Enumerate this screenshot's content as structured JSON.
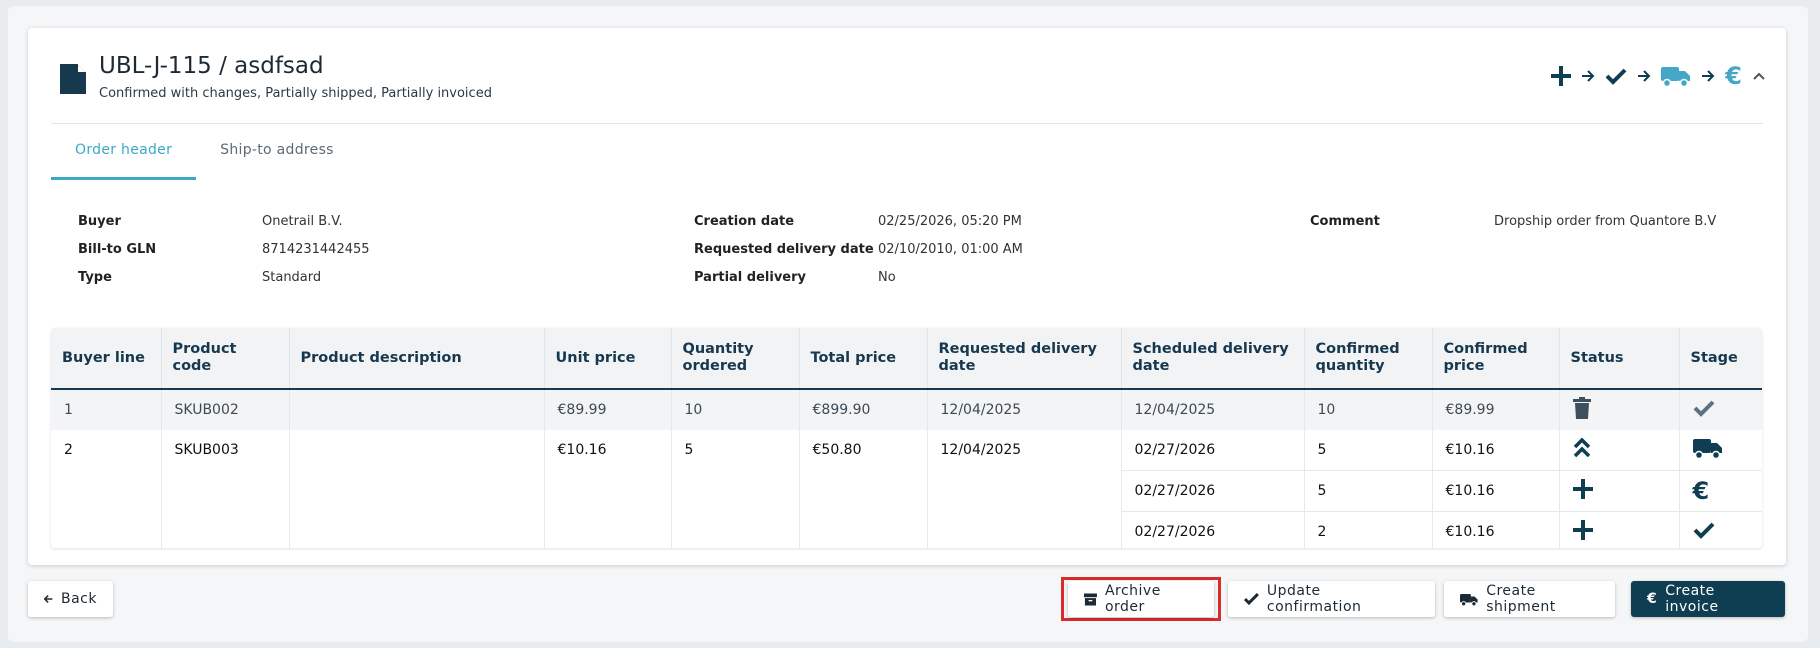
{
  "order": {
    "title": "UBL-J-115 / asdfsad",
    "status_summary": "Confirmed with changes, Partially shipped, Partially invoiced"
  },
  "flow_icons": [
    "plus-icon",
    "arrow-right-icon",
    "check-icon",
    "arrow-right-icon",
    "truck-icon",
    "arrow-right-icon",
    "euro-icon",
    "chevron-up-icon"
  ],
  "tabs": [
    {
      "label": "Order header",
      "active": true
    },
    {
      "label": "Ship-to address",
      "active": false
    }
  ],
  "info": {
    "col1": [
      {
        "key": "Buyer",
        "value": "Onetrail B.V."
      },
      {
        "key": "Bill-to GLN",
        "value": "8714231442455"
      },
      {
        "key": "Type",
        "value": "Standard"
      }
    ],
    "col2": [
      {
        "key": "Creation date",
        "value": "02/25/2026, 05:20 PM"
      },
      {
        "key": "Requested delivery date",
        "value": "02/10/2010, 01:00 AM"
      },
      {
        "key": "Partial delivery",
        "value": "No"
      }
    ],
    "col3": [
      {
        "key": "Comment",
        "value": "Dropship order from Quantore B.V"
      }
    ]
  },
  "table": {
    "headers": [
      "Buyer line",
      "Product code",
      "Product description",
      "Unit price",
      "Quantity ordered",
      "Total price",
      "Requested delivery date",
      "Scheduled delivery date",
      "Confirmed quantity",
      "Confirmed price",
      "Status",
      "Stage"
    ],
    "line1": {
      "buyer_line": "1",
      "product_code": "SKUB002",
      "description": "",
      "unit_price": "€89.99",
      "qty": "10",
      "total": "€899.90",
      "requested": "12/04/2025",
      "schedule": [
        {
          "date": "12/04/2025",
          "qty": "10",
          "price": "€89.99",
          "status_icon": "trash-icon",
          "stage_icon": "check-icon"
        }
      ]
    },
    "line2": {
      "buyer_line": "2",
      "product_code": "SKUB003",
      "description": "",
      "unit_price": "€10.16",
      "qty": "5",
      "total": "€50.80",
      "requested": "12/04/2025",
      "schedule": [
        {
          "date": "02/27/2026",
          "qty": "5",
          "price": "€10.16",
          "status_icon": "double-chevron-up-icon",
          "stage_icon": "truck-icon"
        },
        {
          "date": "02/27/2026",
          "qty": "5",
          "price": "€10.16",
          "status_icon": "plus-icon",
          "stage_icon": "euro-icon"
        },
        {
          "date": "02/27/2026",
          "qty": "2",
          "price": "€10.16",
          "status_icon": "plus-icon",
          "stage_icon": "check-icon"
        }
      ]
    }
  },
  "footer": {
    "back": "Back",
    "archive": "Archive order",
    "update": "Update confirmation",
    "shipment": "Create shipment",
    "invoice": "Create invoice"
  },
  "colors": {
    "primary": "#0f3d52",
    "accent": "#3aa9c6",
    "highlight": "#d92b2b"
  }
}
